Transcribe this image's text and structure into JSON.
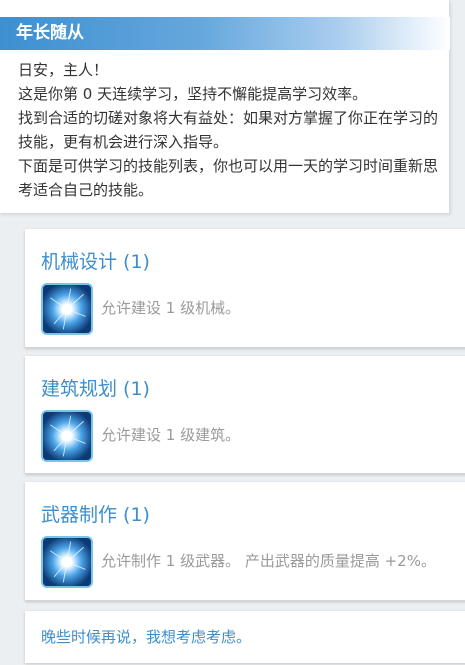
{
  "header": {
    "title": "年长随从"
  },
  "intro": {
    "greeting": "日安，主人！",
    "streak": "这是你第 0 天连续学习，坚持不懈能提高学习效率。",
    "tip": "找到合适的切磋对象将大有益处：如果对方掌握了你正在学习的技能，更有机会进行深入指导。",
    "list_hint": "下面是可供学习的技能列表，你也可以用一天的学习时间重新思考适合自己的技能。"
  },
  "skills": [
    {
      "title": "机械设计 (1)",
      "icon": "blue-burst-icon",
      "description": "允许建设 1 级机械。"
    },
    {
      "title": "建筑规划 (1)",
      "icon": "blue-burst-icon",
      "description": "允许建设 1 级建筑。"
    },
    {
      "title": "武器制作 (1)",
      "icon": "blue-burst-icon",
      "description": "允许制作 1 级武器。 产出武器的质量提高 +2%。"
    }
  ],
  "later_option": {
    "label": "晚些时候再说，我想考虑考虑。"
  },
  "colors": {
    "accent": "#3d8ecb",
    "title_bar_start": "#3d8fd0",
    "description_text": "#9a9a9a",
    "background": "#eceff1"
  }
}
